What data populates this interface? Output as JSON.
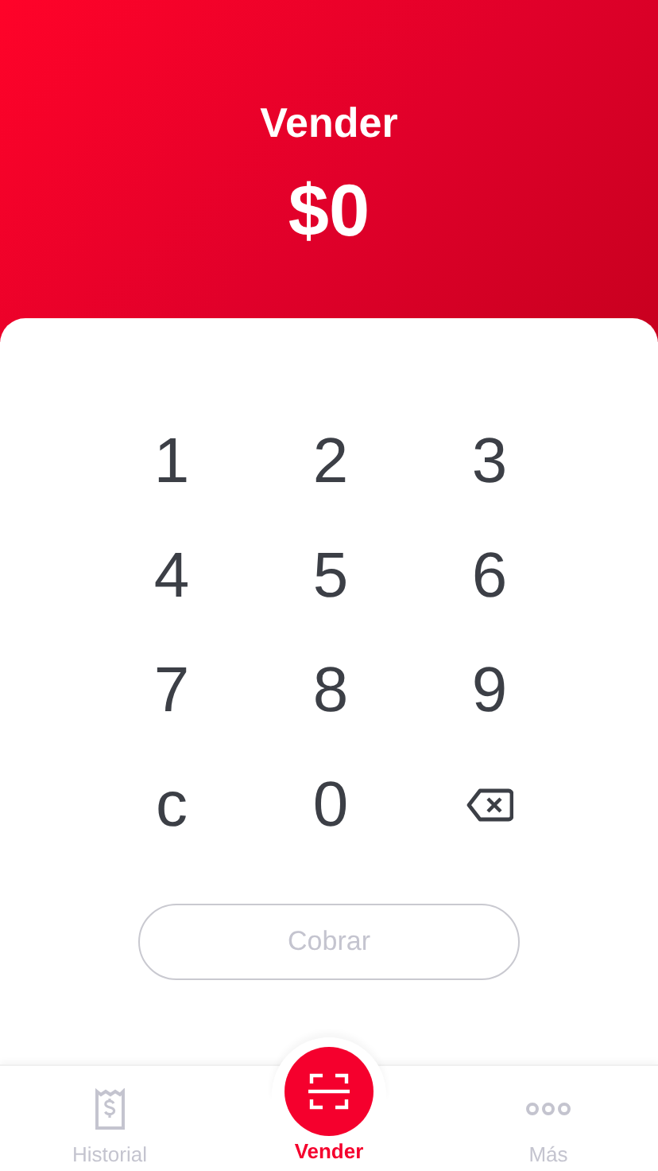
{
  "header": {
    "title": "Vender",
    "amount": "$0"
  },
  "keypad": [
    {
      "kind": "digit",
      "label": "1"
    },
    {
      "kind": "digit",
      "label": "2"
    },
    {
      "kind": "digit",
      "label": "3"
    },
    {
      "kind": "digit",
      "label": "4"
    },
    {
      "kind": "digit",
      "label": "5"
    },
    {
      "kind": "digit",
      "label": "6"
    },
    {
      "kind": "digit",
      "label": "7"
    },
    {
      "kind": "digit",
      "label": "8"
    },
    {
      "kind": "digit",
      "label": "9"
    },
    {
      "kind": "clear",
      "label": "c"
    },
    {
      "kind": "digit",
      "label": "0"
    },
    {
      "kind": "backspace"
    }
  ],
  "charge_button": {
    "label": "Cobrar",
    "disabled": true
  },
  "tab_bar": [
    {
      "kind": "receipt",
      "label": "Historial",
      "selected": false
    },
    {
      "kind": "scan",
      "label": "Vender",
      "selected": true
    },
    {
      "kind": "more",
      "label": "Más",
      "selected": false
    }
  ]
}
